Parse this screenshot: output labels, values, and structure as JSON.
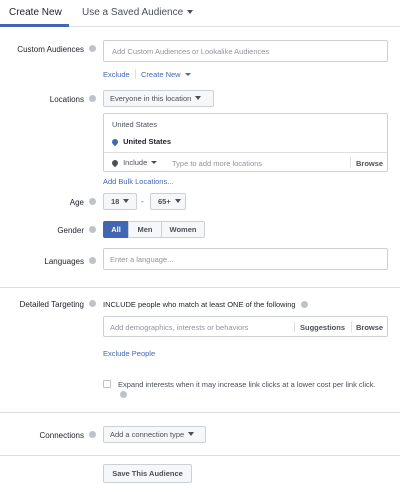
{
  "tabs": [
    {
      "label": "Create New"
    },
    {
      "label": "Use a Saved Audience"
    }
  ],
  "custom_audiences": {
    "label": "Custom Audiences",
    "placeholder": "Add Custom Audiences or Lookalike Audiences",
    "exclude_link": "Exclude",
    "create_new_link": "Create New"
  },
  "locations": {
    "label": "Locations",
    "scope_dropdown": "Everyone in this location",
    "country_header": "United States",
    "selected_location": "United States",
    "include_dropdown": "Include",
    "search_placeholder": "Type to add more locations",
    "browse": "Browse",
    "bulk_link": "Add Bulk Locations..."
  },
  "age": {
    "label": "Age",
    "min": "18",
    "separator": "-",
    "max": "65+"
  },
  "gender": {
    "label": "Gender",
    "options": [
      "All",
      "Men",
      "Women"
    ],
    "selected": "All"
  },
  "languages": {
    "label": "Languages",
    "placeholder": "Enter a language..."
  },
  "detailed_targeting": {
    "label": "Detailed Targeting",
    "include_text": "INCLUDE people who match at least ONE of the following",
    "placeholder": "Add demographics, interests or behaviors",
    "suggestions": "Suggestions",
    "browse": "Browse",
    "exclude_link": "Exclude People",
    "expand_text": "Expand interests when it may increase link clicks at a lower cost per link click."
  },
  "connections": {
    "label": "Connections",
    "dropdown": "Add a connection type"
  },
  "save_button": "Save This Audience",
  "colors": {
    "accent": "#4267b2",
    "border": "#ccd0d5",
    "text": "#1d2129",
    "muted": "#90949c"
  }
}
